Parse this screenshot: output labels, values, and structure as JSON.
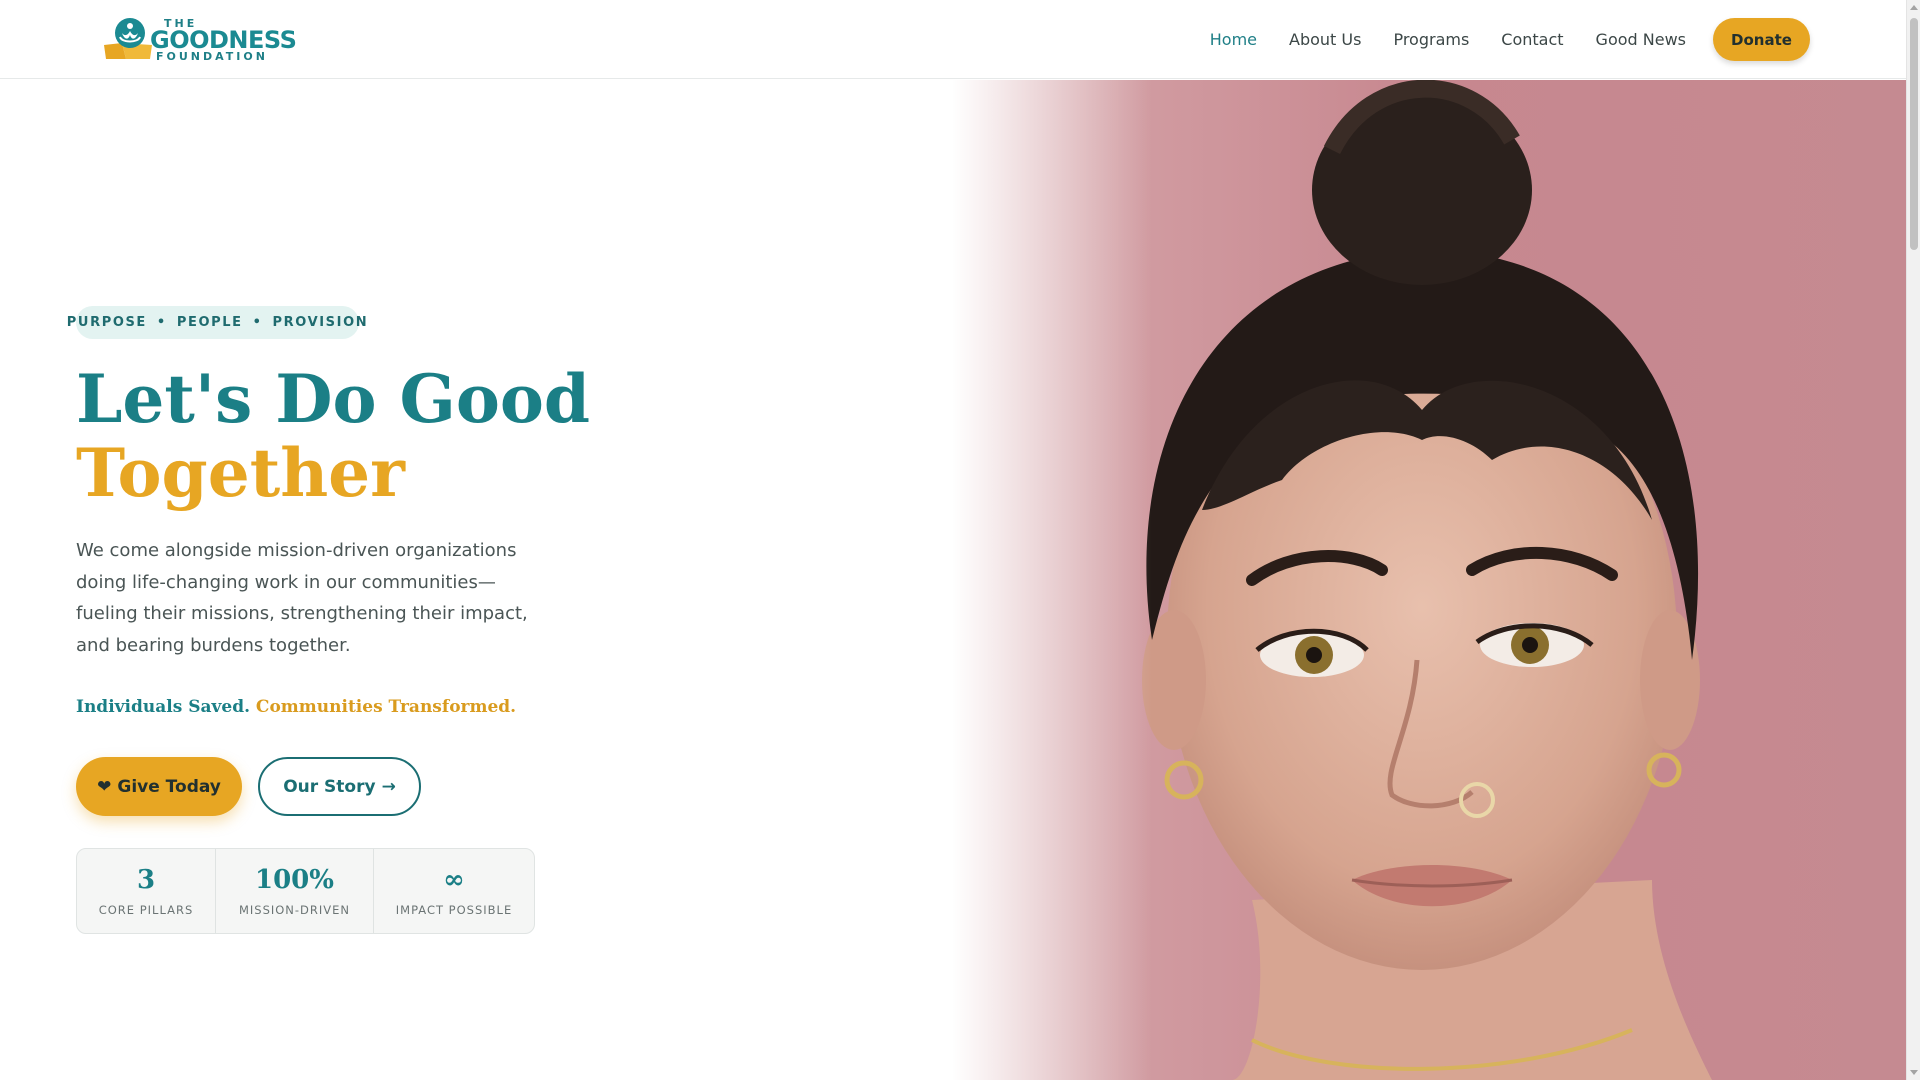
{
  "header": {
    "logo": {
      "line1": "THE",
      "line2": "GOODNESS",
      "line3": "FOUNDATION"
    },
    "nav": [
      {
        "label": "Home",
        "active": true
      },
      {
        "label": "About Us",
        "active": false
      },
      {
        "label": "Programs",
        "active": false
      },
      {
        "label": "Contact",
        "active": false
      },
      {
        "label": "Good News",
        "active": false
      }
    ],
    "donate_label": "Donate"
  },
  "hero": {
    "tagline": [
      "PURPOSE",
      "PEOPLE",
      "PROVISION"
    ],
    "tagline_separator": "•",
    "headline_line1": "Let's Do Good",
    "headline_line2": "Together",
    "intro": "We come alongside mission-driven organizations doing life-changing work in our communities—fueling their missions, strengthening their impact, and bearing burdens together.",
    "slogan_part1": "Individuals Saved.",
    "slogan_part2": "Communities Transformed.",
    "give_label": "Give Today",
    "give_icon": "heart-icon",
    "story_label": "Our Story",
    "story_icon": "arrow-right-icon",
    "image": "portrait-of-woman-on-pink-background",
    "stats": [
      {
        "value": "3",
        "label": "CORE PILLARS"
      },
      {
        "value": "100%",
        "label": "MISSION-DRIVEN"
      },
      {
        "value": "∞",
        "label": "IMPACT POSSIBLE"
      }
    ]
  },
  "colors": {
    "teal": "#1b7f86",
    "gold": "#e7a623",
    "pill_bg": "#e3f3f1",
    "hero_bg": "#c98e95"
  }
}
